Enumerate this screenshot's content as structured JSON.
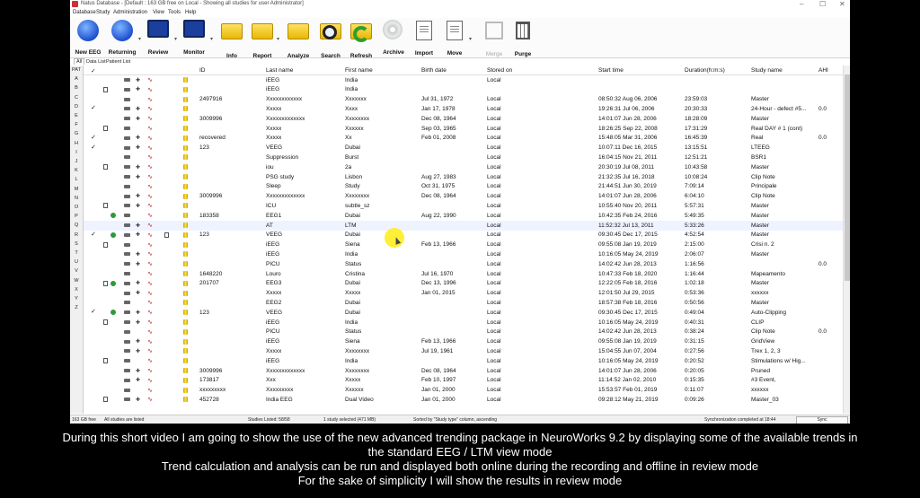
{
  "window": {
    "title": "Natus Database - [Default : 163 GB free on Local - Showing all studies for user Administrator]",
    "controls": [
      "–",
      "☐",
      "✕"
    ]
  },
  "menu": [
    "Database",
    "Study",
    "Administration",
    "View",
    "Tools",
    "Help"
  ],
  "toolbar": [
    {
      "label": "New EEG",
      "icon": "new-eeg-icon",
      "enabled": true
    },
    {
      "label": "Returning",
      "icon": "returning-icon",
      "enabled": true
    },
    {
      "label": "Review",
      "icon": "review-icon",
      "enabled": true
    },
    {
      "label": "Monitor",
      "icon": "monitor-icon",
      "enabled": true
    },
    {
      "label": "Info",
      "icon": "info-icon",
      "enabled": true
    },
    {
      "label": "Report",
      "icon": "report-icon",
      "enabled": true
    },
    {
      "label": "Analyze",
      "icon": "analyze-icon",
      "enabled": true
    },
    {
      "label": "Search",
      "icon": "search-icon",
      "enabled": true
    },
    {
      "label": "Refresh",
      "icon": "refresh-icon",
      "enabled": true
    },
    {
      "label": "Archive",
      "icon": "archive-icon",
      "enabled": true
    },
    {
      "label": "Import",
      "icon": "import-icon",
      "enabled": true
    },
    {
      "label": "Move",
      "icon": "move-icon",
      "enabled": true
    },
    {
      "label": "Merge",
      "icon": "merge-icon",
      "enabled": false
    },
    {
      "label": "Purge",
      "icon": "purge-icon",
      "enabled": true
    }
  ],
  "dropdown_glyph": "▾",
  "tabs": [
    "All",
    "Data List",
    "Patient List"
  ],
  "alpha_index": [
    "PAT",
    "A",
    "B",
    "C",
    "D",
    "E",
    "F",
    "G",
    "H",
    "I",
    "J",
    "K",
    "L",
    "M",
    "N",
    "O",
    "P",
    "Q",
    "R",
    "S",
    "T",
    "U",
    "V",
    "W",
    "X",
    "Y",
    "Z"
  ],
  "columns": {
    "check": "✓",
    "id": "ID",
    "last": "Last name",
    "first": "First name",
    "birth": "Birth date",
    "stored": "Stored on",
    "start": "Start time",
    "duration": "Duration(h:m:s)",
    "study": "Study name",
    "ahi": "AHI"
  },
  "rows": [
    {
      "chk": "",
      "id": "",
      "last": "iEEG",
      "first": "India",
      "birth": "",
      "stored": "Local",
      "start": "",
      "dur": "",
      "study": "",
      "ahi": ""
    },
    {
      "chk": "",
      "id": "",
      "last": "iEEG",
      "first": "India",
      "birth": "",
      "stored": "",
      "start": "",
      "dur": "",
      "study": "",
      "ahi": ""
    },
    {
      "chk": "",
      "id": "2497916",
      "last": "Xxxxxxxxxxxx",
      "first": "Xxxxxxx",
      "birth": "Jul 31, 1972",
      "stored": "Local",
      "start": "08:50:32 Aug 06, 2006",
      "dur": "23:59:03",
      "study": "Master",
      "ahi": ""
    },
    {
      "chk": "✓",
      "id": "",
      "last": "Xxxxx",
      "first": "Xxxx",
      "birth": "Jan 17, 1978",
      "stored": "Local",
      "start": "19:26:31 Jul 06, 2006",
      "dur": "20:30:33",
      "study": "24-Hour - defect #5...",
      "ahi": "0.0"
    },
    {
      "chk": "",
      "id": "3009996",
      "last": "Xxxxxxxxxxxxx",
      "first": "Xxxxxxxx",
      "birth": "Dec 08, 1964",
      "stored": "Local",
      "start": "14:01:07 Jun 28, 2006",
      "dur": "18:28:09",
      "study": "Master",
      "ahi": ""
    },
    {
      "chk": "",
      "id": "",
      "last": "Xxxxx",
      "first": "Xxxxxx",
      "birth": "Sep 03, 1965",
      "stored": "Local",
      "start": "18:26:25 Sep 22, 2008",
      "dur": "17:31:29",
      "study": "Real DAY # 1 (cont)",
      "ahi": ""
    },
    {
      "chk": "✓",
      "id": "recovered",
      "last": "Xxxxx",
      "first": "Xx",
      "birth": "Feb 01, 2008",
      "stored": "Local",
      "start": "15:48:05 Mar 31, 2006",
      "dur": "16:45:39",
      "study": "Real",
      "ahi": "0.0"
    },
    {
      "chk": "✓",
      "id": "123",
      "last": "VEEG",
      "first": "Dubai",
      "birth": "",
      "stored": "Local",
      "start": "10:07:11 Dec 16, 2015",
      "dur": "13:15:51",
      "study": "LTEEG",
      "ahi": ""
    },
    {
      "chk": "",
      "id": "",
      "last": "Suppression",
      "first": "Burst",
      "birth": "",
      "stored": "Local",
      "start": "16:04:15 Nov 21, 2011",
      "dur": "12:51:21",
      "study": "BSR1",
      "ahi": ""
    },
    {
      "chk": "",
      "id": "",
      "last": "iou",
      "first": "2a",
      "birth": "",
      "stored": "Local",
      "start": "20:30:19 Jul 08, 2011",
      "dur": "10:43:58",
      "study": "Master",
      "ahi": ""
    },
    {
      "chk": "",
      "id": "",
      "last": "PSG study",
      "first": "Lisbon",
      "birth": "Aug 27, 1983",
      "stored": "Local",
      "start": "21:32:35 Jul 16, 2018",
      "dur": "10:08:24",
      "study": "Clip Note",
      "ahi": ""
    },
    {
      "chk": "",
      "id": "",
      "last": "Sleep",
      "first": "Study",
      "birth": "Oct 31, 1975",
      "stored": "Local",
      "start": "21:44:51 Jun 30, 2019",
      "dur": "7:09:14",
      "study": "Principale",
      "ahi": ""
    },
    {
      "chk": "",
      "id": "3009996",
      "last": "Xxxxxxxxxxxxx",
      "first": "Xxxxxxxx",
      "birth": "Dec 08, 1964",
      "stored": "Local",
      "start": "14:01:07 Jun 28, 2006",
      "dur": "6:04:10",
      "study": "Clip Note",
      "ahi": ""
    },
    {
      "chk": "",
      "id": "",
      "last": "ICU",
      "first": "subtle_sz",
      "birth": "",
      "stored": "Local",
      "start": "10:55:40 Nov 20, 2011",
      "dur": "5:57:31",
      "study": "Master",
      "ahi": ""
    },
    {
      "chk": "",
      "id": "183358",
      "last": "EEG1",
      "first": "Dubai",
      "birth": "Aug 22, 1990",
      "stored": "Local",
      "start": "10:42:35 Feb 24, 2016",
      "dur": "5:49:35",
      "study": "Master",
      "ahi": ""
    },
    {
      "chk": "",
      "id": "",
      "last": "AT",
      "first": "LTM",
      "birth": "",
      "stored": "Local",
      "start": "11:52:32 Jul 13, 2011",
      "dur": "5:33:26",
      "study": "Master",
      "ahi": ""
    },
    {
      "chk": "✓",
      "id": "123",
      "last": "VEEG",
      "first": "Dubai",
      "birth": "",
      "stored": "Local",
      "start": "09:30:45 Dec 17, 2015",
      "dur": "4:52:54",
      "study": "Master",
      "ahi": ""
    },
    {
      "chk": "",
      "id": "",
      "last": "iEEG",
      "first": "Siena",
      "birth": "Feb 13, 1966",
      "stored": "Local",
      "start": "09:55:08 Jan 19, 2019",
      "dur": "2:15:00",
      "study": "Crisi n. 2",
      "ahi": ""
    },
    {
      "chk": "",
      "id": "",
      "last": "iEEG",
      "first": "India",
      "birth": "",
      "stored": "Local",
      "start": "10:16:05 May 24, 2019",
      "dur": "2:06:07",
      "study": "Master",
      "ahi": ""
    },
    {
      "chk": "",
      "id": "",
      "last": "PICU",
      "first": "Status",
      "birth": "",
      "stored": "Local",
      "start": "14:02:42 Jun 28, 2013",
      "dur": "1:16:56",
      "study": "",
      "ahi": "0.0"
    },
    {
      "chk": "",
      "id": "1648220",
      "last": "Louro",
      "first": "Cristina",
      "birth": "Jul 16, 1970",
      "stored": "Local",
      "start": "10:47:33 Feb 18, 2020",
      "dur": "1:16:44",
      "study": "Mapeamento",
      "ahi": ""
    },
    {
      "chk": "",
      "id": "201707",
      "last": "EEG3",
      "first": "Dubai",
      "birth": "Dec 13, 1996",
      "stored": "Local",
      "start": "12:22:05 Feb 18, 2016",
      "dur": "1:02:18",
      "study": "Master",
      "ahi": ""
    },
    {
      "chk": "",
      "id": "",
      "last": "Xxxxx",
      "first": "Xxxxx",
      "birth": "Jan 01, 2015",
      "stored": "Local",
      "start": "12:01:50 Jul 29, 2015",
      "dur": "0:53:36",
      "study": "xxxxxx",
      "ahi": ""
    },
    {
      "chk": "",
      "id": "",
      "last": "EEG2",
      "first": "Dubai",
      "birth": "",
      "stored": "Local",
      "start": "18:57:38 Feb 18, 2016",
      "dur": "0:50:56",
      "study": "Master",
      "ahi": ""
    },
    {
      "chk": "✓",
      "id": "123",
      "last": "VEEG",
      "first": "Dubai",
      "birth": "",
      "stored": "Local",
      "start": "09:30:45 Dec 17, 2015",
      "dur": "0:49:04",
      "study": "Auto-Clipping",
      "ahi": ""
    },
    {
      "chk": "",
      "id": "",
      "last": "iEEG",
      "first": "India",
      "birth": "",
      "stored": "Local",
      "start": "10:16:05 May 24, 2019",
      "dur": "0:40:31",
      "study": "CLIP",
      "ahi": ""
    },
    {
      "chk": "",
      "id": "",
      "last": "PICU",
      "first": "Status",
      "birth": "",
      "stored": "Local",
      "start": "14:02:42 Jun 28, 2013",
      "dur": "0:38:24",
      "study": "Clip Note",
      "ahi": "0.0"
    },
    {
      "chk": "",
      "id": "",
      "last": "iEEG",
      "first": "Siena",
      "birth": "Feb 13, 1966",
      "stored": "Local",
      "start": "09:55:08 Jan 19, 2019",
      "dur": "0:31:15",
      "study": "GridView",
      "ahi": ""
    },
    {
      "chk": "",
      "id": "",
      "last": "Xxxxx",
      "first": "Xxxxxxxx",
      "birth": "Jul 19, 1961",
      "stored": "Local",
      "start": "15:04:55 Jun 07, 2004",
      "dur": "0:27:56",
      "study": "Trex 1, 2, 3",
      "ahi": ""
    },
    {
      "chk": "",
      "id": "",
      "last": "iEEG",
      "first": "India",
      "birth": "",
      "stored": "Local",
      "start": "10:16:05 May 24, 2019",
      "dur": "0:20:52",
      "study": "Stimulations w/ Hig...",
      "ahi": ""
    },
    {
      "chk": "",
      "id": "3009996",
      "last": "Xxxxxxxxxxxxx",
      "first": "Xxxxxxxx",
      "birth": "Dec 08, 1964",
      "stored": "Local",
      "start": "14:01:07 Jun 28, 2006",
      "dur": "0:20:05",
      "study": "Pruned",
      "ahi": ""
    },
    {
      "chk": "",
      "id": "173817",
      "last": "Xxx",
      "first": "Xxxxx",
      "birth": "Feb 10, 1997",
      "stored": "Local",
      "start": "11:14:52 Jan 02, 2010",
      "dur": "0:15:35",
      "study": "#3 Event,",
      "ahi": ""
    },
    {
      "chk": "",
      "id": "xxxxxxxxx",
      "last": "Xxxxxxxxx",
      "first": "Xxxxxx",
      "birth": "Jan 01, 2000",
      "stored": "Local",
      "start": "15:53:57 Feb 01, 2019",
      "dur": "0:11:07",
      "study": "xxxxxx",
      "ahi": ""
    },
    {
      "chk": "",
      "id": "452728",
      "last": "India EEG",
      "first": "Dual Video",
      "birth": "Jan 01, 2000",
      "stored": "Local",
      "start": "09:28:12 May 21, 2019",
      "dur": "0:09:26",
      "study": "Master_03",
      "ahi": ""
    }
  ],
  "status": {
    "free": "163 GB free",
    "listed": "All studies are listed",
    "count": "Studies Listed: 58/58",
    "selected": "1 study selected (471 MB)",
    "sorted": "Sorted by \"Study type\" column, ascending",
    "sync": "Synchronization completed at 18:44",
    "sync_btn": "Sync"
  },
  "captions": [
    "During this short video I am going to show the use of the new advanced trending package in NeuroWorks 9.2 by displaying some of the available trends in",
    "the standard EEG / LTM view mode",
    "Trend calculation and analysis can be run and displayed both online during the recording and offline in review mode",
    "For the sake of simplicity I will show the results in review mode"
  ],
  "colors": {
    "accent": "#1d4fd0",
    "folder": "#e8b800",
    "cursor_highlight": "#ffee22"
  }
}
